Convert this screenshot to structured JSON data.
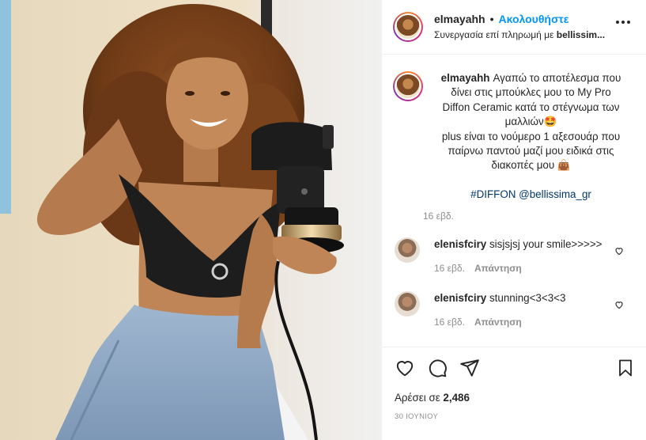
{
  "post": {
    "author": {
      "username": "elmayahh",
      "separator": "•",
      "follow_label": "Ακολουθήστε",
      "partnership_prefix": "Συνεργασία επί πληρωμή με ",
      "partnership_brand": "bellissim..."
    },
    "caption": {
      "username": "elmayahh",
      "line1": "Αγαπώ το αποτέλεσμα που",
      "line2": "δίνει στις μπούκλες μου το My Pro",
      "line3": "Diffon Ceramic κατά το στέγνωμα των",
      "line4": "μαλλιών🤩",
      "line5": "plus είναι το νούμερο 1 αξεσουάρ που",
      "line6": "παίρνω παντού μαζί μου ειδικά στις",
      "line7": "διακοπές μου 👜",
      "tags": "#DIFFON @bellissima_gr",
      "time": "16 εβδ."
    },
    "comments": [
      {
        "username": "elenisfciry",
        "text": "sisjsjsj your smile>>>>>",
        "time": "16 εβδ.",
        "reply_label": "Απάντηση"
      },
      {
        "username": "elenisfciry",
        "text": "stunning<3<3<3",
        "time": "16 εβδ.",
        "reply_label": "Απάντηση"
      }
    ],
    "likes_prefix": "Αρέσει σε ",
    "likes_count": "2,486",
    "date": "30 ΙΟΥΝΙΟΥ"
  },
  "icons": {
    "like": "heart-icon",
    "comment": "comment-bubble-icon",
    "share": "paper-plane-icon",
    "save": "bookmark-icon",
    "more": "more-options-icon",
    "comment_like": "heart-icon"
  },
  "colors": {
    "link_blue": "#0095f6",
    "hashtag_blue": "#00376b",
    "muted_gray": "#8e8e8e",
    "text": "#262626",
    "border": "#efefef"
  }
}
